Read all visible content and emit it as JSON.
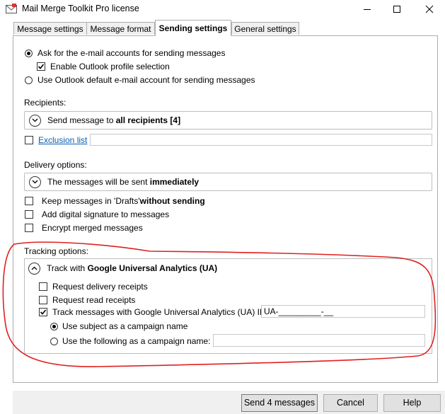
{
  "window": {
    "title": "Mail Merge Toolkit Pro license",
    "icon": "envelope-app-icon"
  },
  "tabs": [
    {
      "label": "Message settings",
      "active": false
    },
    {
      "label": "Message format",
      "active": false
    },
    {
      "label": "Sending settings",
      "active": true
    },
    {
      "label": "General settings",
      "active": false
    }
  ],
  "accounts": {
    "ask_accounts": "Ask for the e-mail accounts for sending messages",
    "enable_profile": "Enable Outlook profile selection",
    "use_default": "Use Outlook default e-mail account for sending messages"
  },
  "recipients": {
    "heading": "Recipients:",
    "summary_prefix": "Send message to ",
    "summary_bold": "all recipients [4]",
    "exclusion_link": "Exclusion list",
    "exclusion_value": ""
  },
  "delivery": {
    "heading": "Delivery options:",
    "summary_prefix": "The messages will be sent ",
    "summary_bold": "immediately",
    "keep_drafts_prefix": "Keep messages in 'Drafts' ",
    "keep_drafts_bold": "without sending",
    "digital_signature": "Add digital signature to messages",
    "encrypt": "Encrypt merged messages"
  },
  "tracking": {
    "heading": "Tracking options:",
    "summary_prefix": "Track with ",
    "summary_bold": "Google Universal Analytics (UA)",
    "delivery_receipts": "Request delivery receipts",
    "read_receipts": "Request read receipts",
    "track_ua": "Track messages with Google Universal Analytics (UA) ID",
    "ua_id_value": "UA-_________-__",
    "use_subject": "Use subject as a campaign name",
    "use_following": "Use the following as a campaign name:",
    "campaign_value": ""
  },
  "buttons": {
    "send": "Send 4 messages",
    "cancel": "Cancel",
    "help": "Help"
  },
  "colors": {
    "annotation": "#e02020",
    "link": "#0a5fb4"
  }
}
